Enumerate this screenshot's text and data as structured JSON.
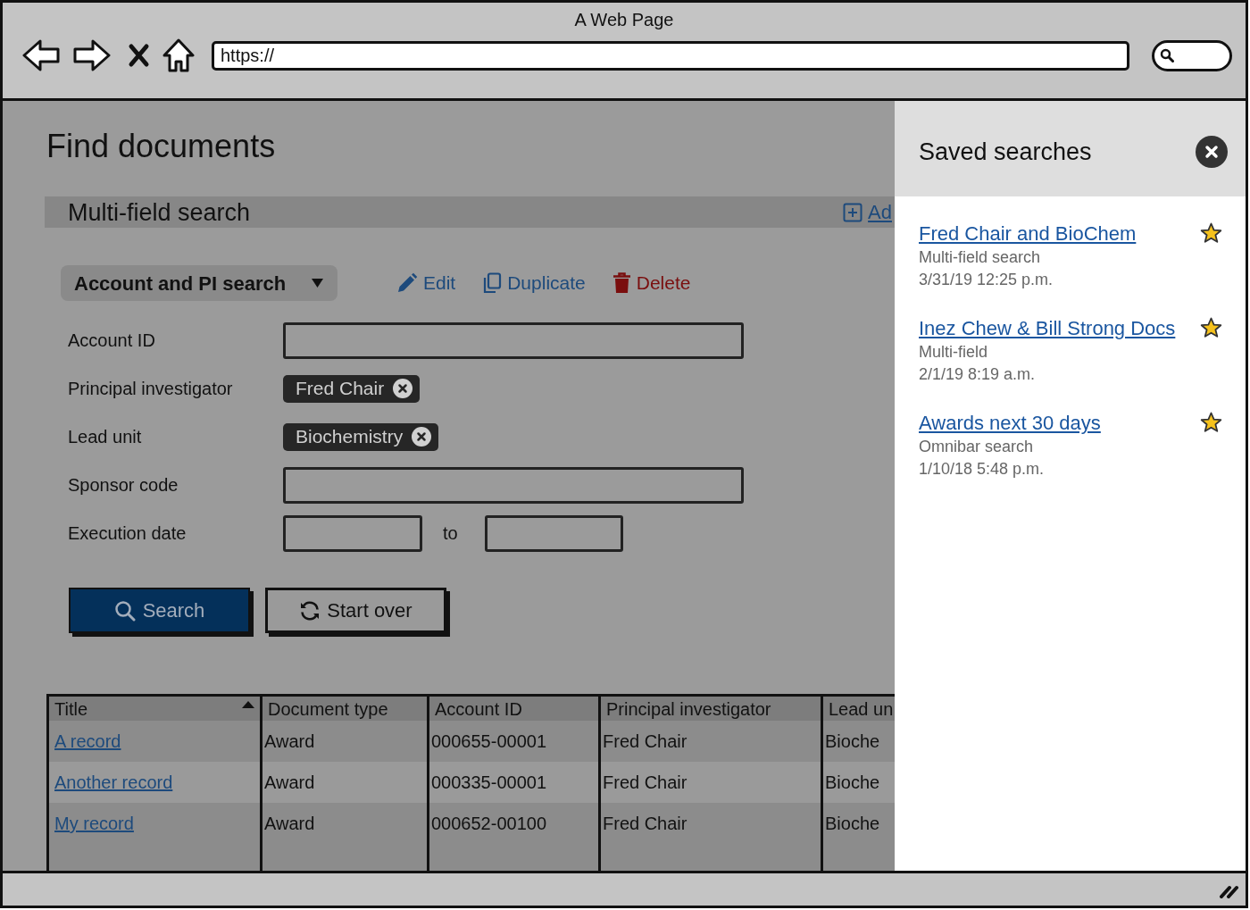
{
  "browser": {
    "title": "A Web Page",
    "url": "https://"
  },
  "page": {
    "heading": "Find documents",
    "section": {
      "title": "Multi-field search",
      "add_link": "Ad"
    },
    "saved_search_menu": {
      "label": "Account and PI search"
    },
    "actions": [
      {
        "kind": "edit",
        "label": "Edit"
      },
      {
        "kind": "duplicate",
        "label": "Duplicate"
      },
      {
        "kind": "delete",
        "label": "Delete"
      }
    ],
    "fields": [
      {
        "kind": "text",
        "label": "Account ID"
      },
      {
        "kind": "tags",
        "label": "Principal investigator",
        "tags": [
          "Fred Chair"
        ]
      },
      {
        "kind": "tags",
        "label": "Lead unit",
        "tags": [
          "Biochemistry"
        ]
      },
      {
        "kind": "text",
        "label": "Sponsor code"
      },
      {
        "kind": "range",
        "label": "Execution date",
        "separator": "to"
      }
    ],
    "buttons": [
      {
        "kind": "search",
        "label": "Search"
      },
      {
        "kind": "reset",
        "label": "Start over"
      }
    ],
    "table": {
      "columns": [
        {
          "label": "Title",
          "sorted": true
        },
        {
          "label": "Document type",
          "sorted": false
        },
        {
          "label": "Account ID",
          "sorted": false
        },
        {
          "label": "Principal investigator",
          "sorted": false
        },
        {
          "label": "Lead un",
          "sorted": false
        }
      ],
      "rows": [
        {
          "cells": [
            "A record",
            "Award",
            "000655-00001",
            "Fred Chair",
            "Bioche"
          ]
        },
        {
          "cells": [
            "Another record",
            "Award",
            "000335-00001",
            "Fred Chair",
            "Bioche"
          ]
        },
        {
          "cells": [
            "My record",
            "Award",
            "000652-00100",
            "Fred Chair",
            "Bioche"
          ]
        }
      ]
    }
  },
  "saved_searches": {
    "title": "Saved searches",
    "items": [
      {
        "name": "Fred Chair and BioChem",
        "type": "Multi-field search",
        "date": "3/31/19 12:25 p.m.",
        "starred": true
      },
      {
        "name": "Inez Chew & Bill Strong Docs",
        "type": "Multi-field",
        "date": "2/1/19 8:19 a.m.",
        "starred": true
      },
      {
        "name": "Awards next 30 days",
        "type": "Omnibar search",
        "date": "1/10/18 5:48 p.m.",
        "starred": true
      }
    ]
  }
}
